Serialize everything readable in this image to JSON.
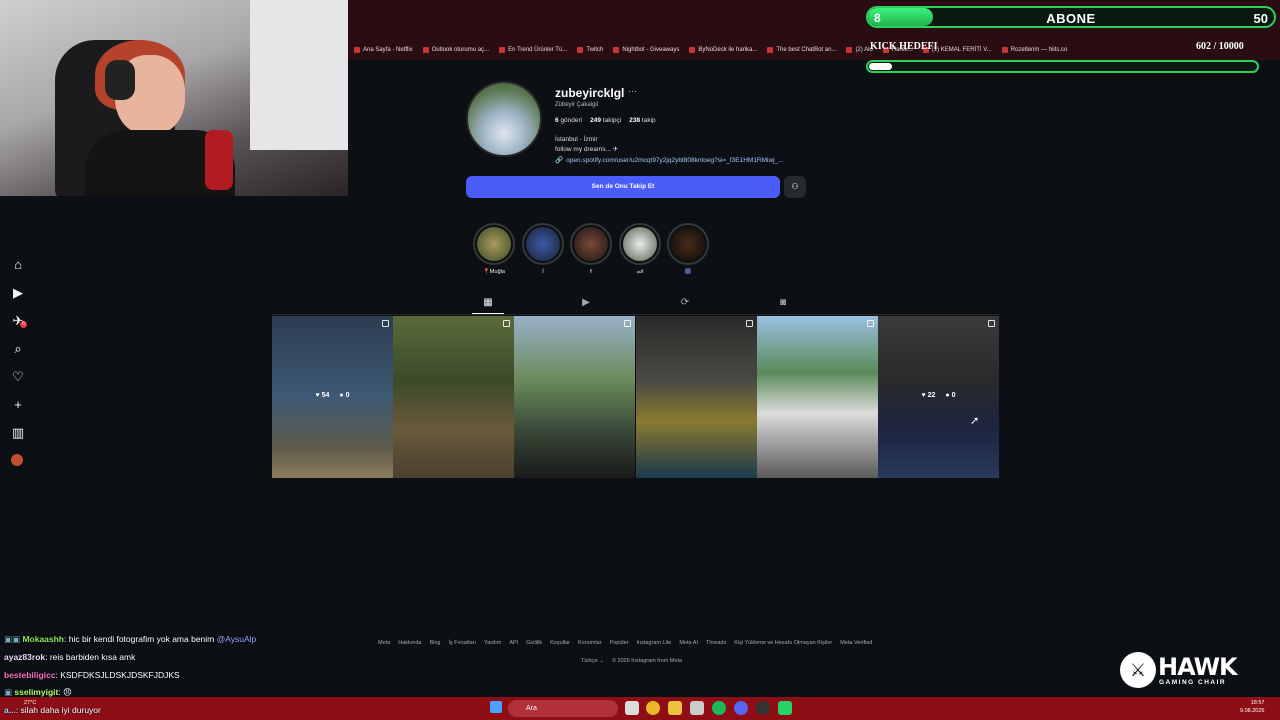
{
  "overlay": {
    "abone_count": "8",
    "abone_label": "ABONE",
    "abone_target": "50",
    "abone_progress": 0.16,
    "kick_label": "KICK HEDEFI",
    "kick_value": "602 / 10000",
    "kick_progress": 0.06
  },
  "bookmarks": [
    "Ana Sayfa - Netflix",
    "Outlook oturumu aç...",
    "En Trend Ürünler Tü...",
    "Twitch",
    "Nightbot - Giveaways",
    "ByNoDeck ile harika...",
    "The best ChatBot an...",
    "(2) Alo",
    "Harek...",
    "(1) KEMAL FERİTİ V...",
    "Rozetlerim — hiits.co"
  ],
  "nav": {
    "notification_badge": "6"
  },
  "profile": {
    "username": "zubeyirckIgl",
    "more": "···",
    "fullname": "Zübeyir Çakalgil",
    "posts": "6",
    "posts_label": "gönderi",
    "followers": "249",
    "followers_label": "takipçi",
    "following": "238",
    "following_label": "takip",
    "bio_line1": "İstanbul - İzmir",
    "bio_line2": "follow my dreams... ✈",
    "link": "open.spotify.com/user/u2mcqt97y2jq2ybt808kntoeg?si=_f3E1HM1RMiwj_...",
    "follow_button": "Sen de Onu Takip Et",
    "suggest_icon": "add-user-icon"
  },
  "highlights": [
    {
      "label": "📍Muğla"
    },
    {
      "label": "İ"
    },
    {
      "label": "✌"
    },
    {
      "label": "🏎"
    },
    {
      "label": "🎆"
    }
  ],
  "posts": [
    {
      "likes": "54",
      "comments": "0",
      "show_overlay": true
    },
    {
      "likes": "",
      "comments": "",
      "show_overlay": false
    },
    {
      "likes": "",
      "comments": "",
      "show_overlay": false
    },
    {
      "likes": "",
      "comments": "",
      "show_overlay": false
    },
    {
      "likes": "",
      "comments": "",
      "show_overlay": false
    },
    {
      "likes": "22",
      "comments": "0",
      "show_overlay": true
    }
  ],
  "footer": {
    "links": [
      "Meta",
      "Hakkında",
      "Blog",
      "İş Fırsatları",
      "Yardım",
      "API",
      "Gizlilik",
      "Koşullar",
      "Konumlar",
      "Popüler",
      "Instagram Lite",
      "Meta AI",
      "Threads",
      "Kişi Yükleme ve Hesabı Olmayan Kişiler",
      "Meta Verified"
    ],
    "language": "Türkçe ⌄",
    "copyright": "© 2026 Instagram from Meta"
  },
  "chat": [
    {
      "user": "Mokaashh",
      "message": ": hic bir kendi fotografim yok ama benim ",
      "mention": "@AysuAlp",
      "color": "#8fe35a"
    },
    {
      "user": "ayaz83rok",
      "message": ": reis barbiden kısa amk",
      "mention": "",
      "color": "#e9d7ff"
    },
    {
      "user": "bestebiligicc",
      "message": ": KSDFDKSJLDSKJDSKFJDJKS",
      "mention": "",
      "color": "#ff6fc2"
    },
    {
      "user": "sselimyigit",
      "message": ": ",
      "mention": "",
      "color": "#b4ff6a"
    },
    {
      "user": "a...",
      "message": ": silah daha iyi duruyor",
      "mention": "",
      "color": "#9ad0ff"
    }
  ],
  "hawk": {
    "name": "HAWK",
    "subtitle": "GAMING CHAIR"
  },
  "taskbar": {
    "search_placeholder": "Ara",
    "time": "18:57",
    "date": "9.08.2026",
    "weather": "27°C"
  }
}
